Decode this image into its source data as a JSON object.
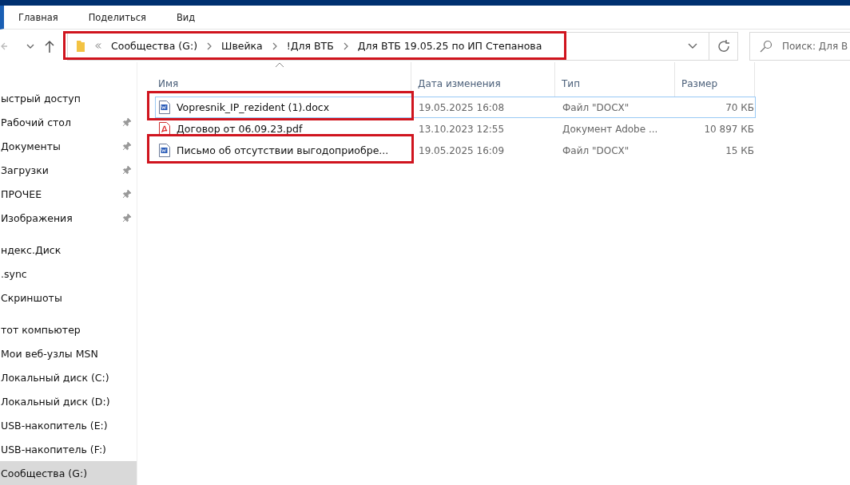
{
  "ribbon": {
    "tabs": [
      {
        "label": "Главная"
      },
      {
        "label": "Поделиться"
      },
      {
        "label": "Вид"
      }
    ]
  },
  "address_bar": {
    "highlighted": true,
    "path": [
      {
        "label": "Сообщества (G:)"
      },
      {
        "label": "Швейка"
      },
      {
        "label": "!Для ВТБ"
      },
      {
        "label": "Для ВТБ 19.05.25 по ИП Степанова"
      }
    ]
  },
  "search": {
    "placeholder": "Поиск: Для В"
  },
  "sidebar": {
    "groups": [
      {
        "items": [
          {
            "label": "ыстрый доступ",
            "pinned": false,
            "selected": false
          },
          {
            "label": "Рабочий стол",
            "pinned": true,
            "selected": false
          },
          {
            "label": "Документы",
            "pinned": true,
            "selected": false
          },
          {
            "label": "Загрузки",
            "pinned": true,
            "selected": false
          },
          {
            "label": "ПРОЧЕЕ",
            "pinned": true,
            "selected": false
          },
          {
            "label": "Изображения",
            "pinned": true,
            "selected": false
          }
        ]
      },
      {
        "items": [
          {
            "label": "ндекс.Диск",
            "pinned": false,
            "selected": false
          },
          {
            "label": ".sync",
            "pinned": false,
            "selected": false
          },
          {
            "label": "Скриншоты",
            "pinned": false,
            "selected": false
          }
        ]
      },
      {
        "items": [
          {
            "label": "тот компьютер",
            "pinned": false,
            "selected": false
          },
          {
            "label": "Мои веб-узлы MSN",
            "pinned": false,
            "selected": false
          },
          {
            "label": "Локальный диск (C:)",
            "pinned": false,
            "selected": false
          },
          {
            "label": "Локальный диск (D:)",
            "pinned": false,
            "selected": false
          },
          {
            "label": "USB-накопитель (E:)",
            "pinned": false,
            "selected": false
          },
          {
            "label": "USB-накопитель (F:)",
            "pinned": false,
            "selected": false
          },
          {
            "label": "Сообщества (G:)",
            "pinned": false,
            "selected": true
          }
        ]
      }
    ]
  },
  "table": {
    "columns": [
      "Имя",
      "Дата изменения",
      "Тип",
      "Размер"
    ],
    "rows": [
      {
        "kind": "docx",
        "name": "Vopresnik_IP_rezident (1).docx",
        "date": "19.05.2025 16:08",
        "type": "Файл \"DOCX\"",
        "size": "70 КБ",
        "selected": true,
        "highlighted": true
      },
      {
        "kind": "pdf",
        "name": "Договор от 06.09.23.pdf",
        "date": "13.10.2023 12:55",
        "type": "Документ Adobe ...",
        "size": "10 897 КБ",
        "selected": false,
        "highlighted": false
      },
      {
        "kind": "docx",
        "name": "Письмо об отсутствии выгодоприобре...",
        "date": "19.05.2025 16:09",
        "type": "Файл \"DOCX\"",
        "size": "15 КБ",
        "selected": false,
        "highlighted": true
      }
    ]
  }
}
